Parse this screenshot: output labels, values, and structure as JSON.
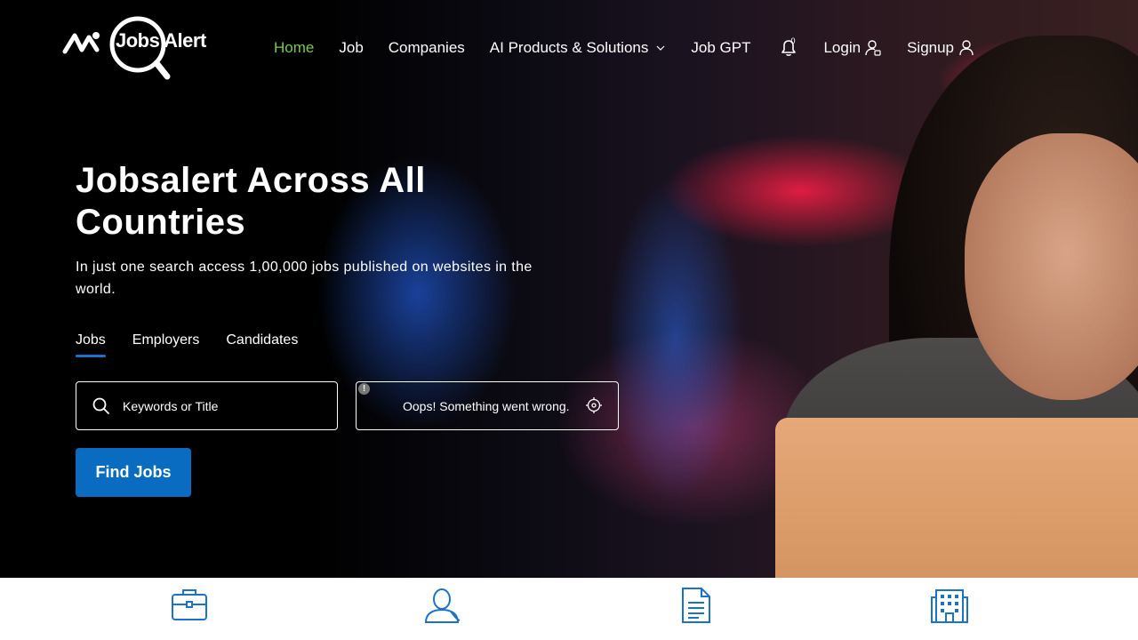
{
  "brand": {
    "name": "Jobs Alert"
  },
  "nav": {
    "items": [
      {
        "label": "Home",
        "active": true
      },
      {
        "label": "Job"
      },
      {
        "label": "Companies"
      },
      {
        "label": "AI Products & Solutions"
      },
      {
        "label": "Job GPT"
      }
    ],
    "notifications_count": "0",
    "login_label": "Login",
    "signup_label": "Signup"
  },
  "hero": {
    "title": "Jobsalert Across All Countries",
    "subtitle": "In just one search access 1,00,000 jobs published on websites in the world."
  },
  "search": {
    "tabs": [
      {
        "label": "Jobs",
        "active": true
      },
      {
        "label": "Employers"
      },
      {
        "label": "Candidates"
      }
    ],
    "keyword_placeholder": "Keywords or Title",
    "location_error": "Oops! Something went wrong.",
    "error_badge": "!",
    "button_label": "Find Jobs"
  },
  "colors": {
    "accent_green": "#7ac943",
    "primary_blue": "#0a6cc0",
    "icon_blue": "#1a73c8"
  },
  "categories": [
    {
      "icon": "briefcase-icon"
    },
    {
      "icon": "user-icon"
    },
    {
      "icon": "document-icon"
    },
    {
      "icon": "building-icon"
    }
  ]
}
